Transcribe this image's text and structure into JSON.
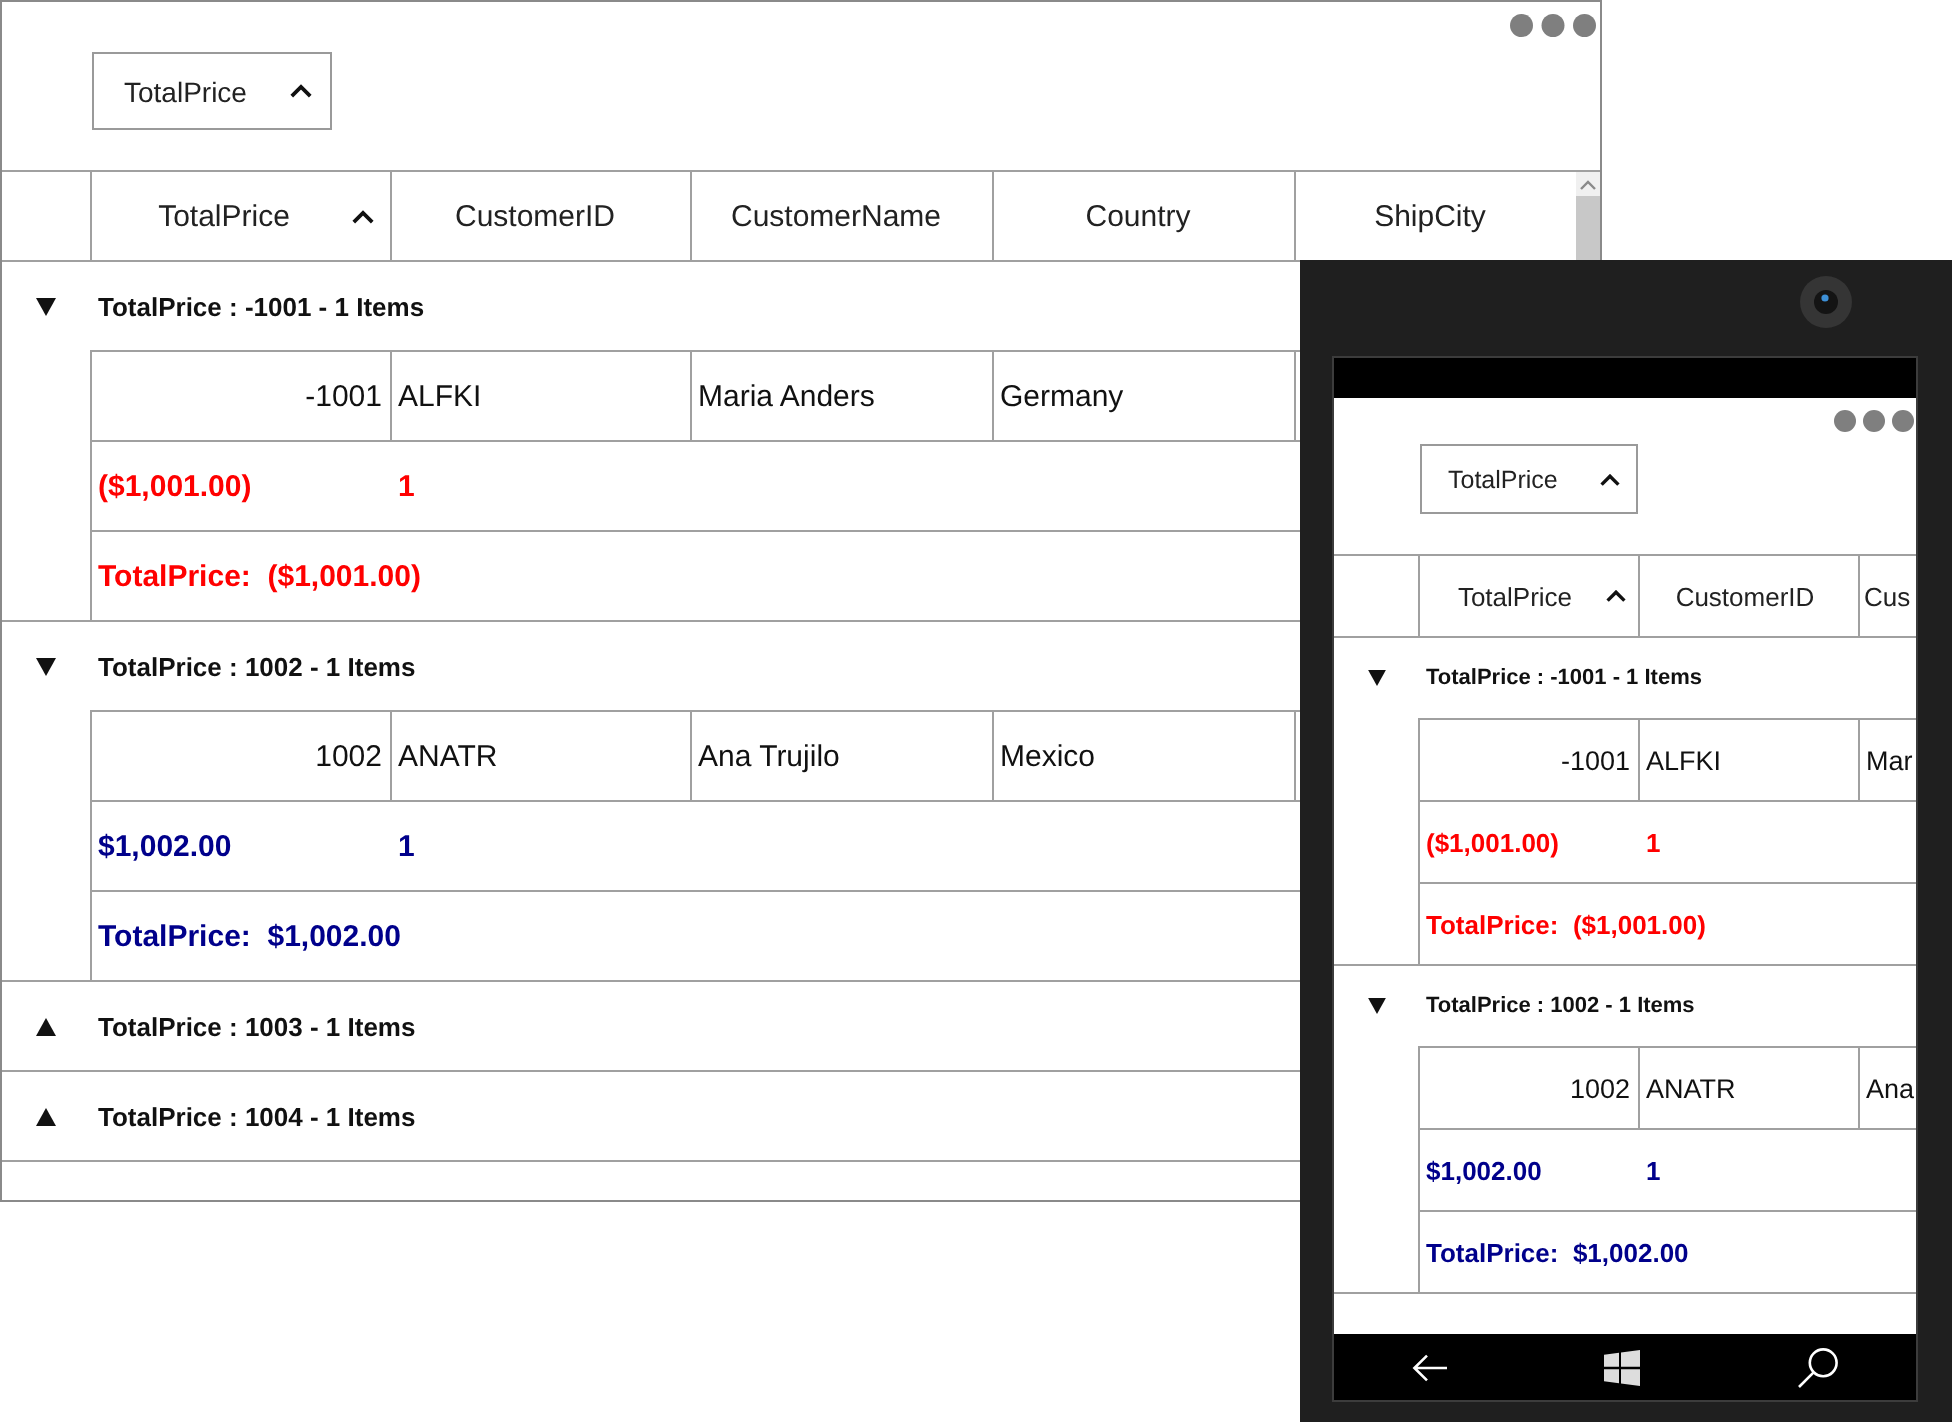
{
  "desktop_window": {
    "group_drop_area": {
      "chips": [
        {
          "label": "TotalPrice",
          "sorted": true
        }
      ]
    },
    "columns": [
      {
        "label": "TotalPrice",
        "sorted": true
      },
      {
        "label": "CustomerID"
      },
      {
        "label": "CustomerName"
      },
      {
        "label": "Country"
      },
      {
        "label": "ShipCity"
      }
    ],
    "groups": [
      {
        "caption": "TotalPrice : -1001 - 1 Items",
        "expanded": true,
        "color": "#ff0000",
        "rows": [
          {
            "cells": [
              "-1001",
              "ALFKI",
              "Maria Anders",
              "Germany"
            ]
          }
        ],
        "summary_row": [
          "($1,001.00)",
          "1"
        ],
        "group_summary": "TotalPrice:  ($1,001.00)"
      },
      {
        "caption": "TotalPrice : 1002 - 1 Items",
        "expanded": true,
        "color": "#00008b",
        "rows": [
          {
            "cells": [
              "1002",
              "ANATR",
              "Ana Trujilo",
              "Mexico"
            ]
          }
        ],
        "summary_row": [
          "$1,002.00",
          "1"
        ],
        "group_summary": "TotalPrice:  $1,002.00"
      },
      {
        "caption": "TotalPrice : 1003 - 1 Items",
        "expanded": false
      },
      {
        "caption": "TotalPrice : 1004 - 1 Items",
        "expanded": false
      }
    ]
  },
  "phone": {
    "group_drop_area": {
      "chips": [
        {
          "label": "TotalPrice",
          "sorted": true
        }
      ]
    },
    "columns": [
      {
        "label": "TotalPrice",
        "sorted": true
      },
      {
        "label": "CustomerID"
      },
      {
        "label": "Cus"
      }
    ],
    "groups": [
      {
        "caption": "TotalPrice : -1001 - 1 Items",
        "expanded": true,
        "color": "#ff0000",
        "rows": [
          {
            "cells": [
              "-1001",
              "ALFKI",
              "Mar"
            ]
          }
        ],
        "summary_row": [
          "($1,001.00)",
          "1"
        ],
        "group_summary": "TotalPrice:  ($1,001.00)"
      },
      {
        "caption": "TotalPrice : 1002 - 1 Items",
        "expanded": true,
        "color": "#00008b",
        "rows": [
          {
            "cells": [
              "1002",
              "ANATR",
              "Ana"
            ]
          }
        ],
        "summary_row": [
          "$1,002.00",
          "1"
        ],
        "group_summary": "TotalPrice:  $1,002.00"
      }
    ]
  }
}
